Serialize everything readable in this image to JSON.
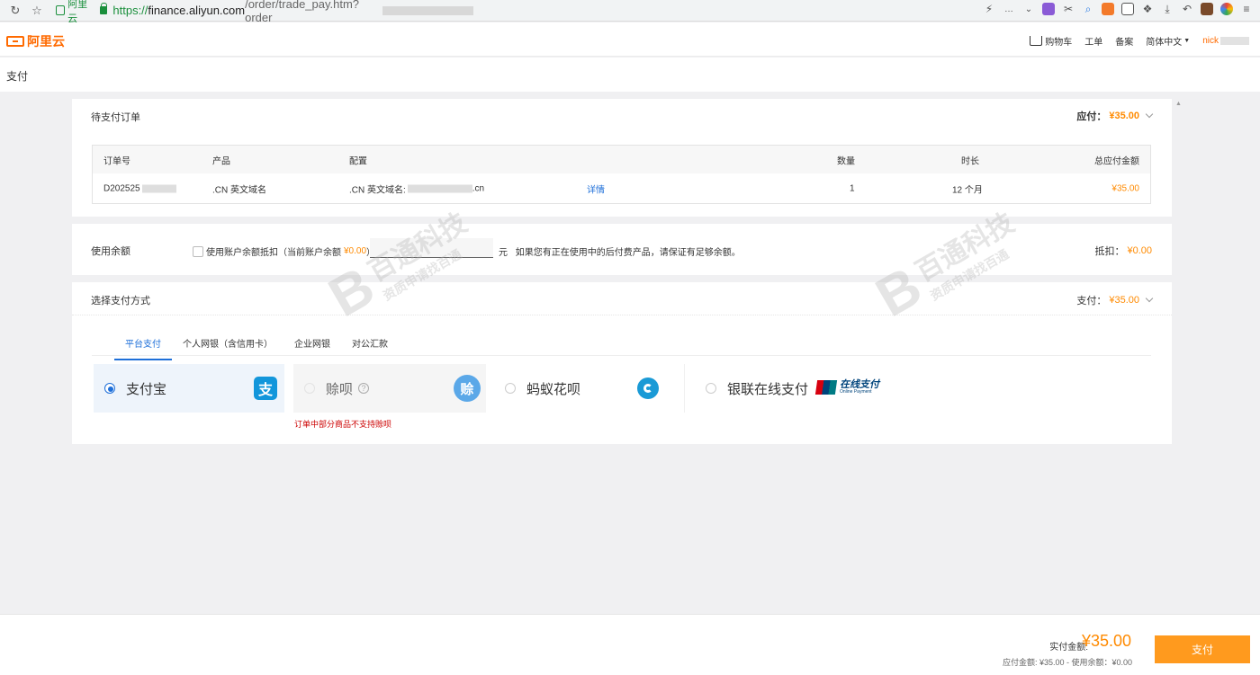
{
  "browser": {
    "site_chip": "阿里云",
    "url_proto": "https://",
    "url_host": "finance.aliyun.com",
    "url_path": "/order/trade_pay.htm?order_"
  },
  "header": {
    "logo_text": "阿里云",
    "cart": "购物车",
    "ticket": "工单",
    "record": "备案",
    "language": "简体中文",
    "user": "nick"
  },
  "page": {
    "title": "支付"
  },
  "order": {
    "title": "待支付订单",
    "due_label": "应付：",
    "due_amount": "¥35.00",
    "columns": [
      "订单号",
      "产品",
      "配置",
      "数量",
      "时长",
      "总应付金额"
    ],
    "row": {
      "order_no": "D202525",
      "product": ".CN 英文域名",
      "config_prefix": ".CN 英文域名:",
      "config_suffix": ".cn",
      "detail_link": "详情",
      "quantity": "1",
      "duration": "12 个月",
      "total": "¥35.00"
    }
  },
  "balance": {
    "title": "使用余额",
    "checkbox_label": "使用账户余额抵扣（当前账户余额",
    "current_balance": "¥0.00",
    "checkbox_suffix": "）",
    "unit": "元",
    "note": "如果您有正在使用中的后付费产品，请保证有足够余额。",
    "deduct_label": "抵扣：",
    "deduct_amount": "¥0.00"
  },
  "payment": {
    "title": "选择支付方式",
    "pay_label": "支付：",
    "pay_amount": "¥35.00",
    "tabs": [
      "平台支付",
      "个人网银（含信用卡）",
      "企业网银",
      "对公汇款"
    ],
    "options": {
      "alipay": "支付宝",
      "alipay_logo": "支",
      "credit": "赊呗",
      "credit_logo": "赊",
      "huabei": "蚂蚁花呗",
      "unionpay": "银联在线支付",
      "unionpay_logo_main": "在线支付",
      "unionpay_logo_sub": "Online Payment"
    },
    "warning": "订单中部分商品不支持赊呗"
  },
  "watermark": {
    "main": "百通科技",
    "sub": "资质申请找百通"
  },
  "footer": {
    "actual_label": "实付金额:",
    "actual_amount": "¥35.00",
    "breakdown": "应付金额: ¥35.00 - 使用余额：¥0.00",
    "pay_button": "支付"
  },
  "colors": {
    "accent_orange": "#ff8a00",
    "link_blue": "#1e6fd9",
    "alipay_blue": "#1296db"
  }
}
